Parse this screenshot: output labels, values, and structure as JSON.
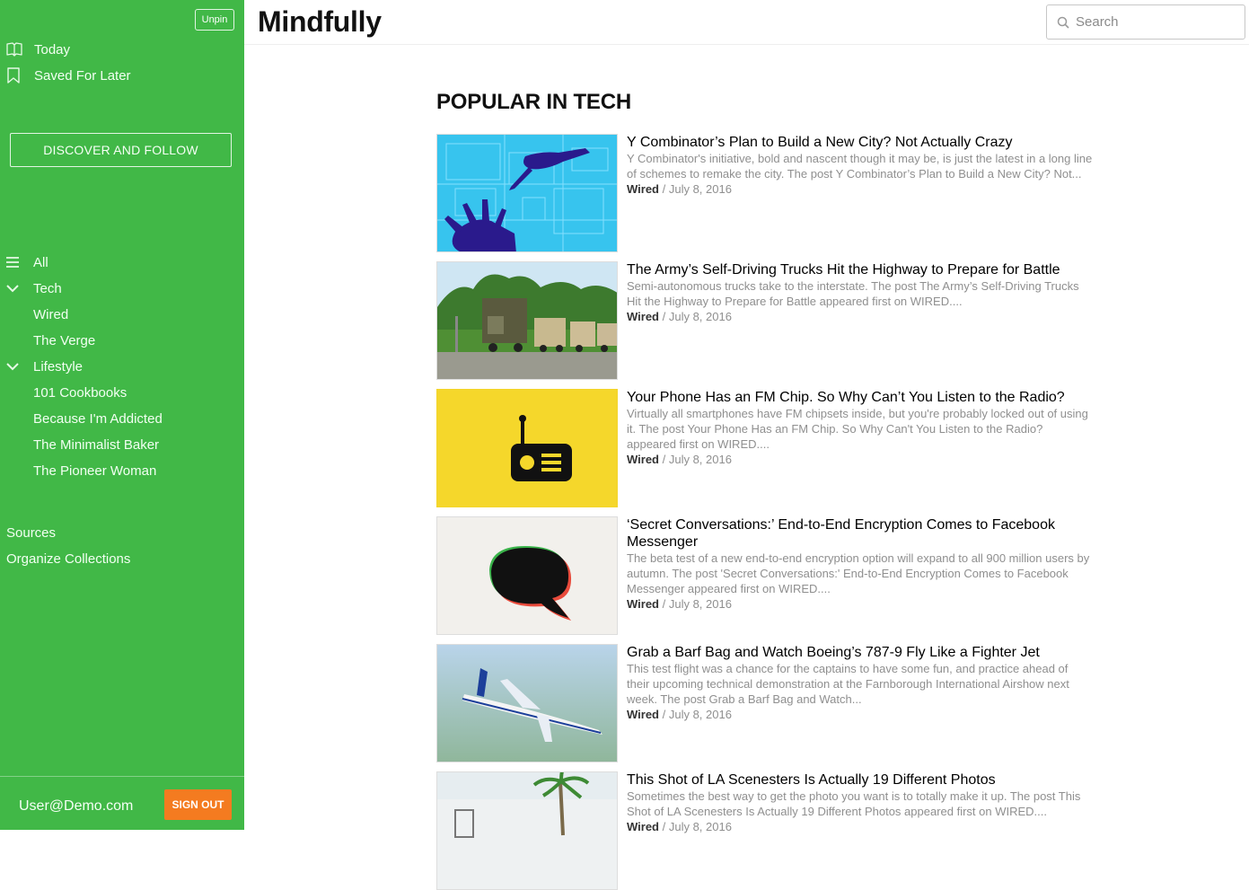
{
  "app": {
    "title": "Mindfully"
  },
  "sidebar": {
    "unpin_label": "Unpin",
    "primary": [
      {
        "label": "Today",
        "icon": "book-open-icon"
      },
      {
        "label": "Saved For Later",
        "icon": "bookmark-icon"
      }
    ],
    "discover_label": "DISCOVER AND FOLLOW",
    "collections": {
      "all_label": "All",
      "groups": [
        {
          "label": "Tech",
          "sources": [
            "Wired",
            "The Verge"
          ]
        },
        {
          "label": "Lifestyle",
          "sources": [
            "101 Cookbooks",
            "Because I'm Addicted",
            "The Minimalist Baker",
            "The Pioneer Woman"
          ]
        }
      ]
    },
    "links": [
      "Sources",
      "Organize Collections"
    ],
    "user_email": "User@Demo.com",
    "signout_label": "SIGN OUT",
    "colors": {
      "background": "#41b847",
      "signout": "#f47b20"
    }
  },
  "search": {
    "placeholder": "Search",
    "value": ""
  },
  "main": {
    "section_title": "POPULAR IN TECH",
    "articles": [
      {
        "title": "Y Combinator’s Plan to Build a New City? Not Actually Crazy",
        "excerpt": "Y Combinator's initiative, bold and nascent though it may be, is just the latest in a long line of schemes to remake the city. The post Y Combinator’s Plan to Build a New City? Not...",
        "source": "Wired",
        "date": " / July 8, 2016",
        "thumb": "blueprint-hands"
      },
      {
        "title": "The Army’s Self-Driving Trucks Hit the Highway to Prepare for Battle",
        "excerpt": "Semi-autonomous trucks take to the interstate. The post The Army’s Self-Driving Trucks Hit the Highway to Prepare for Battle appeared first on WIRED....",
        "source": "Wired",
        "date": " / July 8, 2016",
        "thumb": "army-trucks"
      },
      {
        "title": "Your Phone Has an FM Chip. So Why Can’t You Listen to the Radio?",
        "excerpt": "Virtually all smartphones have FM chipsets inside, but you're probably locked out of using it. The post Your Phone Has an FM Chip. So Why Can't You Listen to the Radio? appeared first on WIRED....",
        "source": "Wired",
        "date": " / July 8, 2016",
        "thumb": "radio-icon"
      },
      {
        "title": "‘Secret Conversations:’ End-to-End Encryption Comes to Facebook Messenger",
        "excerpt": "The beta test of a new end-to-end encryption option will expand to all 900 million users by autumn. The post 'Secret Conversations:' End-to-End Encryption Comes to Facebook Messenger appeared first on WIRED....",
        "source": "Wired",
        "date": " / July 8, 2016",
        "thumb": "speech-bubble"
      },
      {
        "title": "Grab a Barf Bag and Watch Boeing’s 787-9 Fly Like a Fighter Jet",
        "excerpt": "This test flight was a chance for the captains to have some fun, and practice ahead of their upcoming technical demonstration at the Farnborough International Airshow next week. The post Grab a Barf Bag and Watch...",
        "source": "Wired",
        "date": " / July 8, 2016",
        "thumb": "airplane"
      },
      {
        "title": "This Shot of LA Scenesters Is Actually 19 Different Photos",
        "excerpt": "Sometimes the best way to get the photo you want is to totally make it up. The post This Shot of LA Scenesters Is Actually 19 Different Photos appeared first on WIRED....",
        "source": "Wired",
        "date": " / July 8, 2016",
        "thumb": "palm-tree"
      }
    ]
  }
}
